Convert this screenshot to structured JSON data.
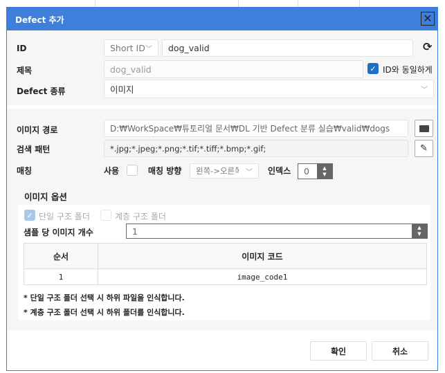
{
  "dialog": {
    "title": "Defect 추가",
    "close_icon": "close-icon"
  },
  "id": {
    "label": "ID",
    "type_value": "Short ID",
    "value": "dog_valid",
    "refresh_icon": "refresh-icon"
  },
  "title_field": {
    "label": "제목",
    "value": "dog_valid",
    "same_as_id_label": "ID와 동일하게",
    "same_as_id_checked": true
  },
  "defect_type": {
    "label": "Defect 종류",
    "value": "이미지"
  },
  "image_path": {
    "label": "이미지 경로",
    "value": "D:₩WorkSpace₩튜토리얼 문서₩DL 기반 Defect 분류 실습₩valid₩dogs",
    "folder_icon": "folder-open-icon"
  },
  "search_pattern": {
    "label": "검색 패턴",
    "value": "*.jpg;*.jpeg;*.png;*.tif;*.tiff;*.bmp;*.gif;",
    "edit_icon": "pencil-icon"
  },
  "matching": {
    "label": "매칭",
    "use_label": "사용",
    "use_checked": false,
    "direction_label": "매칭 방향",
    "direction_value": "왼쪽->오른쪽",
    "index_label": "인덱스",
    "index_value": "0"
  },
  "image_options": {
    "title": "이미지 옵션",
    "single_label": "단일 구조 폴더",
    "single_checked": true,
    "hier_label": "계층 구조 폴더",
    "hier_checked": false,
    "count_label": "샘플 당 이미지 개수",
    "count_value": "1",
    "table": {
      "headers": [
        "순서",
        "이미지 코드"
      ],
      "rows": [
        [
          "1",
          "image_code1"
        ]
      ]
    },
    "notes": [
      "* 단일 구조 폴더 선택 시 하위 파일을 인식합니다.",
      "* 계층 구조 폴더 선택 시 하위 폴더를 인식합니다."
    ]
  },
  "buttons": {
    "ok": "확인",
    "cancel": "취소"
  }
}
